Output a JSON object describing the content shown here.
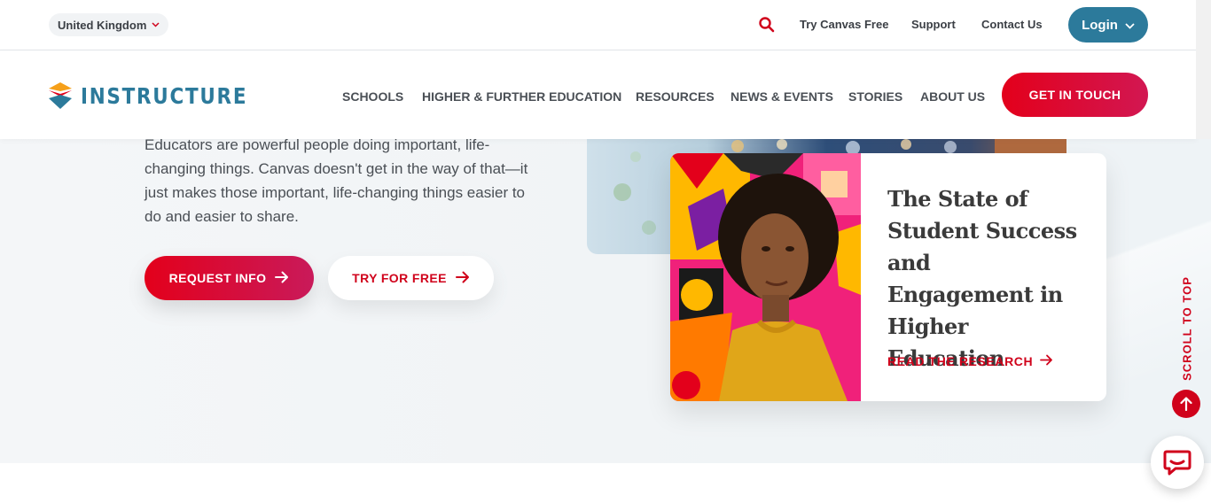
{
  "utility_bar": {
    "region": "United Kingdom",
    "links": [
      "Try Canvas Free",
      "Support",
      "Contact Us"
    ],
    "login": "Login"
  },
  "nav": {
    "logo_text": "INSTRUCTURE",
    "items": [
      "SCHOOLS",
      "HIGHER & FURTHER EDUCATION",
      "RESOURCES",
      "NEWS & EVENTS",
      "STORIES",
      "ABOUT US"
    ],
    "cta": "GET IN TOUCH"
  },
  "hero": {
    "body": "Educators are powerful people doing important, life-changing things. Canvas doesn't get in the way of that—it just makes those important, life-changing things easier to do and easier to share.",
    "request_button": "REQUEST INFO",
    "try_button": "TRY FOR FREE"
  },
  "card": {
    "title": "The State of Student Success and Engagement in Higher Education",
    "link": "READ THE RESEARCH"
  },
  "scroll_to_top": "SCROLL TO TOP",
  "icons": [
    "search-icon",
    "chevron-down-icon",
    "arrow-right-icon",
    "arrow-up-icon",
    "chat-icon"
  ],
  "colors": {
    "brand_red": "#d0021b",
    "brand_teal": "#2c7a9b",
    "text_dark": "#3b3f45"
  }
}
